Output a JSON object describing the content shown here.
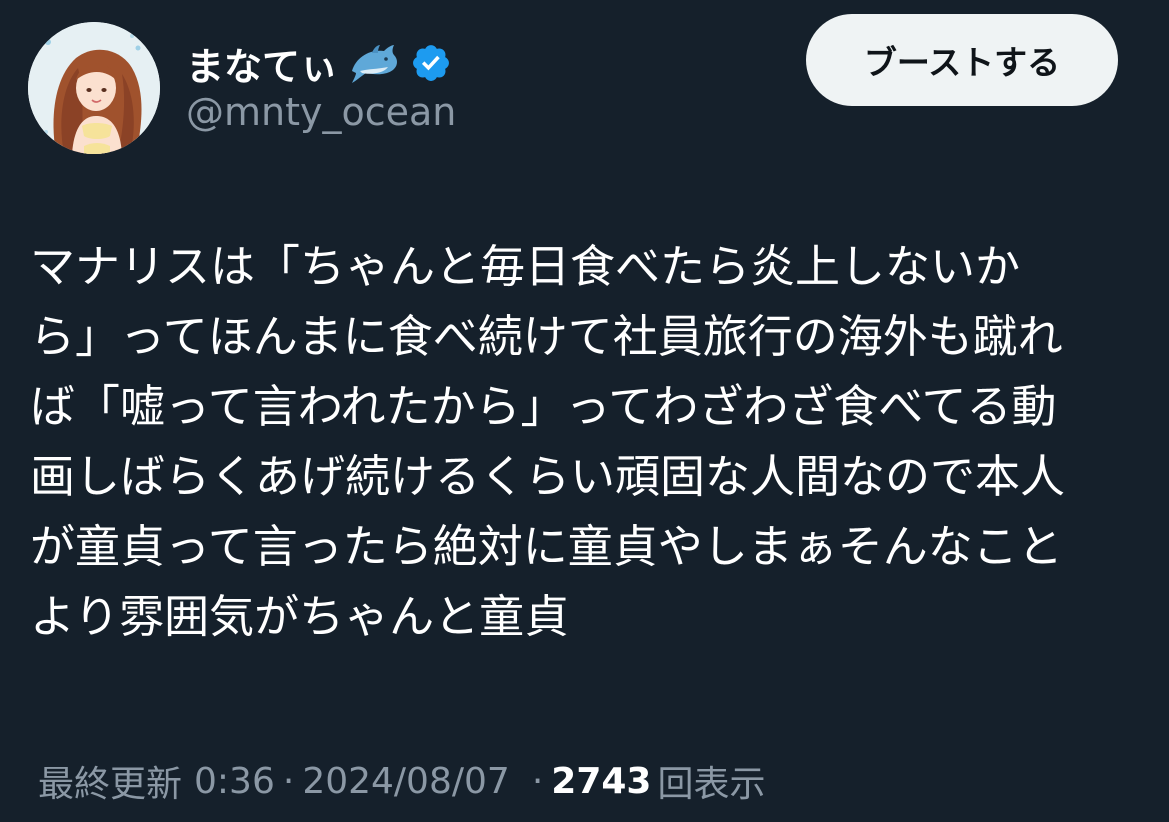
{
  "author": {
    "display_name": "まなてぃ",
    "handle": "@mnty_ocean",
    "name_emoji": "dolphin-icon",
    "verified": true,
    "verified_color": "#1d9bf0"
  },
  "actions": {
    "boost_label": "ブーストする"
  },
  "post": {
    "text": "マナリスは「ちゃんと毎日食べたら炎上しないか\nら」ってほんまに食べ続けて社員旅行の海外も蹴れ\nば「嘘って言われたから」ってわざわざ食べてる動\n画しばらくあげ続けるくらい頑固な人間なので本人\nが童貞って言ったら絶対に童貞やしまぁそんなこと\nより雰囲気がちゃんと童貞"
  },
  "meta": {
    "updated_label": "最終更新",
    "time": "0:36",
    "separator": "·",
    "date": "2024/08/07",
    "views_count": "2743",
    "views_label": "回表示"
  },
  "colors": {
    "background": "#15202b",
    "text_primary": "#ffffff",
    "text_secondary": "#8b98a5",
    "button_bg": "#eff3f4",
    "button_text": "#0f1419"
  }
}
